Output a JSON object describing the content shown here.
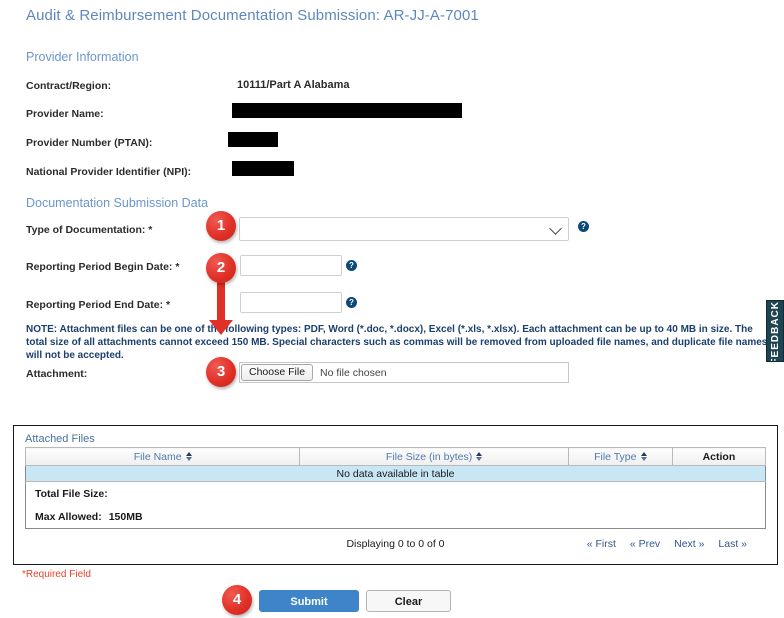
{
  "page_title": "Audit & Reimbursement Documentation Submission: AR-JJ-A-7001",
  "provider_section": {
    "heading": "Provider Information",
    "fields": [
      {
        "label": "Contract/Region:",
        "value": "10111/Part A Alabama",
        "redacted": false
      },
      {
        "label": "Provider Name:",
        "value": "",
        "redacted": true
      },
      {
        "label": "Provider Number (PTAN):",
        "value": "",
        "redacted": true
      },
      {
        "label": "National Provider Identifier (NPI):",
        "value": "",
        "redacted": true
      }
    ]
  },
  "doc_section": {
    "heading": "Documentation Submission Data",
    "type_of_documentation": {
      "label": "Type of Documentation:",
      "required_mark": " *",
      "selected": "",
      "options": [
        ""
      ],
      "help_glyph": "?"
    },
    "begin_date": {
      "label": "Reporting Period Begin Date:",
      "required_mark": " *",
      "value": "",
      "placeholder": "",
      "help_glyph": "?"
    },
    "end_date": {
      "label": "Reporting Period End Date:",
      "required_mark": " *",
      "value": "",
      "placeholder": "",
      "help_glyph": "?"
    },
    "note": "NOTE: Attachment files can be one of the following types: PDF, Word (*.doc, *.docx), Excel (*.xls, *.xlsx).  Each attachment can be up to 40 MB in size.   The total size of all attachments cannot exceed 150 MB. Special characters such as commas will be removed from uploaded file names, and duplicate file names will not be accepted.",
    "attachment": {
      "label": "Attachment:",
      "choose_button": "Choose File",
      "file_status": "No file chosen"
    }
  },
  "attached_files": {
    "panel_title": "Attached Files",
    "columns": [
      {
        "label": "File Name",
        "sortable": true
      },
      {
        "label": "File Size (in bytes)",
        "sortable": true
      },
      {
        "label": "File Type",
        "sortable": true
      },
      {
        "label": "Action",
        "sortable": false
      }
    ],
    "empty_message": "No data available in table",
    "rows": [],
    "total_file_size_label": "Total File Size:",
    "total_file_size_value": "",
    "max_allowed_label": "Max Allowed:",
    "max_allowed_value": "150MB",
    "paging_info": "Displaying 0 to 0 of 0",
    "paging_links": [
      {
        "label": "« First"
      },
      {
        "label": "« Prev"
      },
      {
        "label": "Next »"
      },
      {
        "label": "Last »"
      }
    ]
  },
  "footer": {
    "required_note": "*Required Field",
    "submit_label": "Submit",
    "clear_label": "Clear"
  },
  "feedback_tab": {
    "label": "FEEDBACK"
  },
  "annotations": [
    {
      "number": "1"
    },
    {
      "number": "2"
    },
    {
      "number": "3"
    },
    {
      "number": "4"
    }
  ],
  "colors": {
    "title_blue": "#5f87bf",
    "heading_blue": "#6c96cc",
    "note_blue": "#1d3f6e",
    "required_red": "#e8422c",
    "submit_blue": "#3d85c8",
    "table_row_highlight": "#c9e6f5",
    "badge_red": "#e03127",
    "feedback_teal": "#1d4450"
  }
}
